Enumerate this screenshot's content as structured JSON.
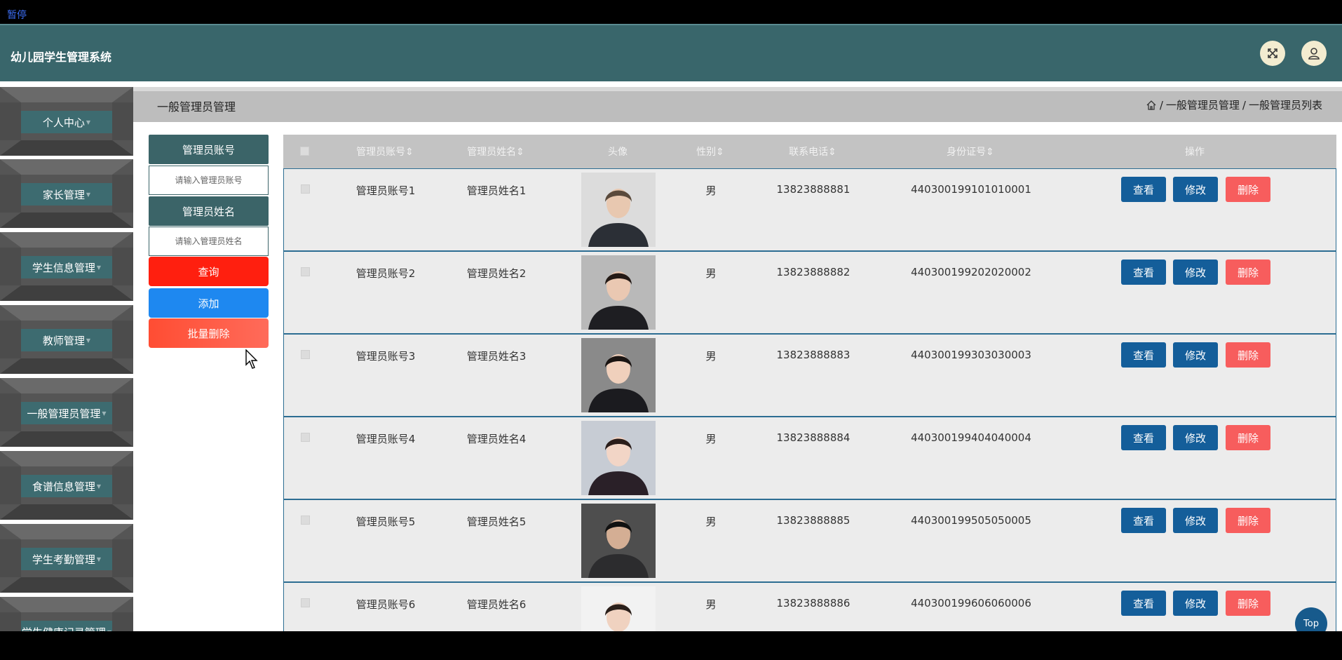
{
  "player": {
    "status": "暂停"
  },
  "header": {
    "title": "幼儿园学生管理系统",
    "icons": [
      "fullscreen-icon",
      "user-icon"
    ]
  },
  "sidebar": {
    "items": [
      {
        "label": "个人中心"
      },
      {
        "label": "家长管理"
      },
      {
        "label": "学生信息管理"
      },
      {
        "label": "教师管理"
      },
      {
        "label": "一般管理员管理"
      },
      {
        "label": "食谱信息管理"
      },
      {
        "label": "学生考勤管理"
      },
      {
        "label": "学生健康记录管理"
      }
    ]
  },
  "page": {
    "title": "一般管理员管理",
    "breadcrumb": [
      "一般管理员管理",
      "一般管理员列表"
    ],
    "separator": "/"
  },
  "search": {
    "account_label": "管理员账号",
    "account_placeholder": "请输入管理员账号",
    "name_label": "管理员姓名",
    "name_placeholder": "请输入管理员姓名",
    "query_button": "查询",
    "add_button": "添加",
    "batch_delete_button": "批量删除"
  },
  "table": {
    "headers": [
      "管理员账号",
      "管理员姓名",
      "头像",
      "性别",
      "联系电话",
      "身份证号",
      "操作"
    ],
    "sort_mark": "⇕",
    "actions": {
      "view": "查看",
      "edit": "修改",
      "delete": "删除"
    },
    "rows": [
      {
        "account": "管理员账号1",
        "name": "管理员姓名1",
        "gender": "男",
        "phone": "13823888881",
        "id_card": "440300199101010001"
      },
      {
        "account": "管理员账号2",
        "name": "管理员姓名2",
        "gender": "男",
        "phone": "13823888882",
        "id_card": "440300199202020002"
      },
      {
        "account": "管理员账号3",
        "name": "管理员姓名3",
        "gender": "男",
        "phone": "13823888883",
        "id_card": "440300199303030003"
      },
      {
        "account": "管理员账号4",
        "name": "管理员姓名4",
        "gender": "男",
        "phone": "13823888884",
        "id_card": "440300199404040004"
      },
      {
        "account": "管理员账号5",
        "name": "管理员姓名5",
        "gender": "男",
        "phone": "13823888885",
        "id_card": "440300199505050005"
      },
      {
        "account": "管理员账号6",
        "name": "管理员姓名6",
        "gender": "男",
        "phone": "13823888886",
        "id_card": "440300199606060006"
      }
    ]
  },
  "top_button": "Top",
  "colors": {
    "header": "#39666b",
    "sidebar_label": "#3d6b70",
    "query": "#ff1f0f",
    "add": "#1e88f0",
    "batch_delete": "#ff5a4a",
    "view": "#145e9a",
    "edit": "#145e9a",
    "delete": "#f75d5d"
  }
}
